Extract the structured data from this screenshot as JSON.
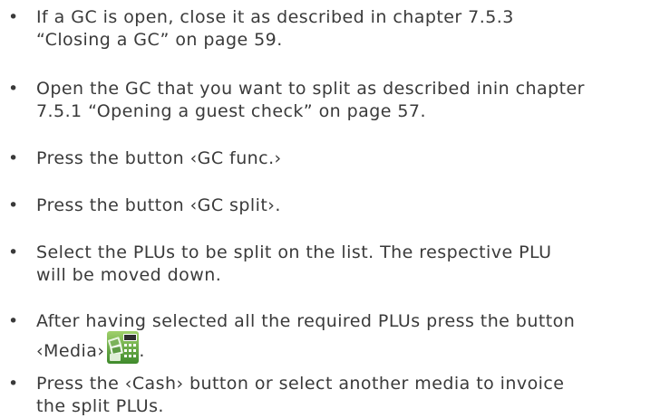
{
  "document": {
    "items": [
      {
        "text": "If a GC is open, close it as described in chapter 7.5.3\n“Closing a GC” on page 59."
      },
      {
        "text": "Open the GC that you want to split as described inin chapter\n7.5.1 “Opening a guest check” on page 57."
      },
      {
        "text": "Press the button ‹GC func.›"
      },
      {
        "text": "Press the button ‹GC split›."
      },
      {
        "text": "Select the PLUs to be split on the list. The respective PLU\nwill be moved down."
      },
      {
        "text_line1": "After having selected all the required PLUs press the button",
        "text_line2": "‹Media›",
        "text_after_icon": ".",
        "icon": "media-icon"
      },
      {
        "text": "Press the ‹Cash› button or select another media to invoice\nthe split PLUs."
      }
    ],
    "bullet_char": "•"
  }
}
